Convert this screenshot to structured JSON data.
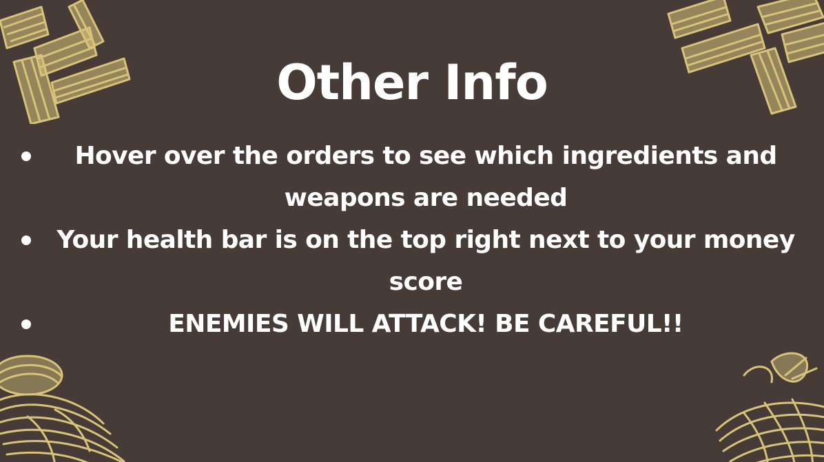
{
  "slide": {
    "title": "Other Info",
    "bullets": [
      {
        "text": "Hover over the orders to see which ingredients and weapons are needed"
      },
      {
        "text": "Your health bar is on the top right next to your money score"
      },
      {
        "text": "ENEMIES WILL ATTACK! BE CAREFUL!!"
      }
    ]
  },
  "colors": {
    "background": "#463b37",
    "text": "#ffffff",
    "decoration": "#d8c37a"
  },
  "decorations": {
    "top_left": "penne-pasta-illustration",
    "top_right": "penne-pasta-illustration",
    "bottom_left": "spaghetti-nest-illustration",
    "bottom_right": "spaghetti-nest-illustration"
  }
}
